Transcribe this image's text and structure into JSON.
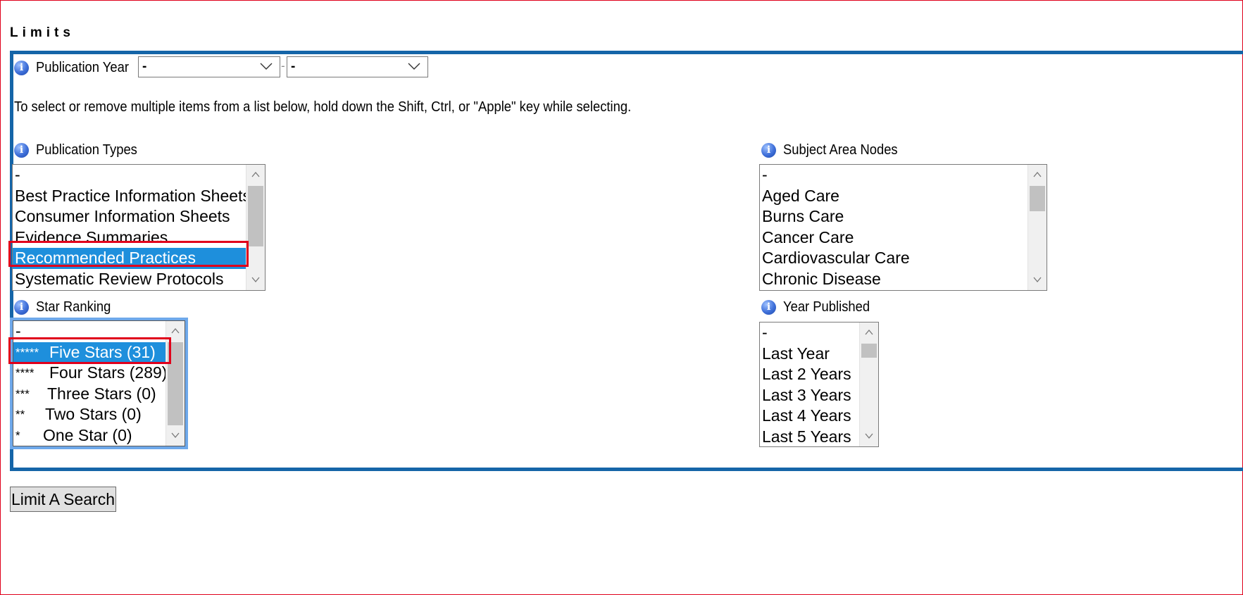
{
  "title": "Limits",
  "publication_year": {
    "label": "Publication Year",
    "from_value": "-",
    "separator": "-",
    "to_value": "-"
  },
  "instructions": "To select or remove multiple items from a list below, hold down the Shift, Ctrl, or \"Apple\" key while selecting.",
  "publication_types": {
    "label": "Publication Types",
    "options": [
      "-",
      "Best Practice Information Sheets",
      "Consumer Information Sheets",
      "Evidence Summaries",
      "Recommended Practices",
      "Systematic Review Protocols"
    ],
    "selected": "Recommended Practices"
  },
  "subject_area_nodes": {
    "label": "Subject Area Nodes",
    "options": [
      "-",
      "Aged Care",
      "Burns Care",
      "Cancer Care",
      "Cardiovascular Care",
      "Chronic Disease"
    ]
  },
  "star_ranking": {
    "label": "Star Ranking",
    "options": [
      {
        "stars": "-",
        "text": ""
      },
      {
        "stars": "*****",
        "text": "Five Stars (31)"
      },
      {
        "stars": "****",
        "text": "Four Stars (289)"
      },
      {
        "stars": "***",
        "text": "Three Stars (0)"
      },
      {
        "stars": "**",
        "text": "Two Stars (0)"
      },
      {
        "stars": "*",
        "text": "One Star (0)"
      }
    ],
    "selected": "Five Stars (31)"
  },
  "year_published": {
    "label": "Year Published",
    "options": [
      "-",
      "Last Year",
      "Last 2 Years",
      "Last 3 Years",
      "Last 4 Years",
      "Last 5 Years"
    ]
  },
  "submit_label": "Limit A Search",
  "colors": {
    "panel_border": "#1565a8",
    "highlight_box": "#e0001b",
    "selection": "#1e8fdc",
    "focus_ring": "#6ea8ea"
  },
  "icons": [
    "info-icon",
    "chevron-down-icon",
    "scroll-up-arrow-icon",
    "scroll-down-arrow-icon"
  ]
}
